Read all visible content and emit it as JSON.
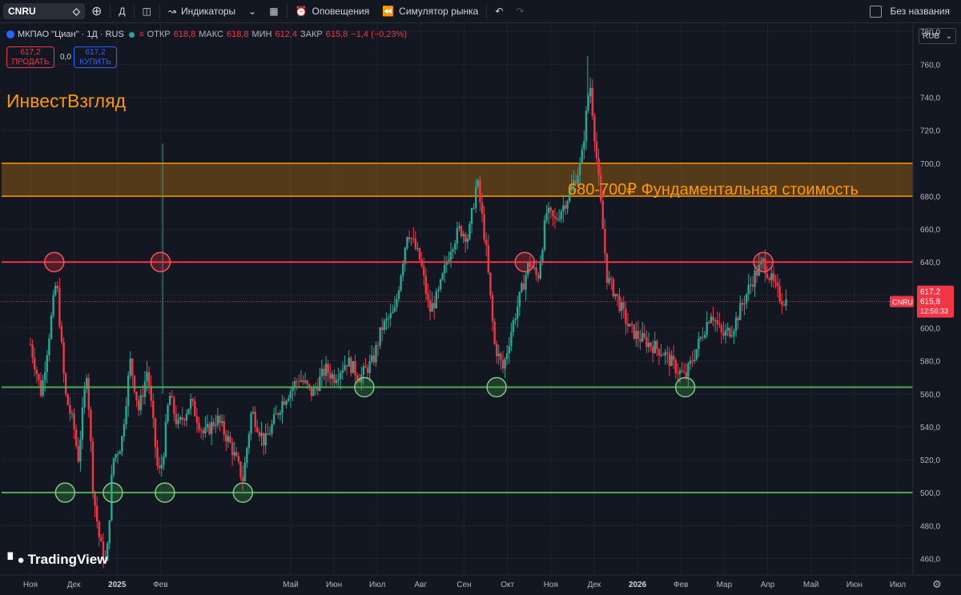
{
  "toolbar": {
    "symbol": "CNRU",
    "interval": "Д",
    "indicators": "Индикаторы",
    "alerts": "Оповещения",
    "replay": "Симулятор рынка",
    "layout_name": "Без названия"
  },
  "legend": {
    "title": "МКПАО \"Циан\" · 1Д · RUS",
    "open_label": "ОТКР",
    "open": "618,8",
    "high_label": "МАКС",
    "high": "618,8",
    "low_label": "МИН",
    "low": "612,4",
    "close_label": "ЗАКР",
    "close": "615,8",
    "change": "−1,4 (−0,23%)"
  },
  "trade": {
    "sell_price": "617,2",
    "sell_label": "ПРОДАТЬ",
    "spread": "0,0",
    "buy_price": "617,2",
    "buy_label": "КУПИТЬ"
  },
  "currency": "RUB",
  "annotations": {
    "author": "ИнвестВзгляд",
    "zone_label": "680-700₽ Фундаментальная стоимость"
  },
  "price_tags": {
    "symbol": "CNRU",
    "bid": "617,2",
    "last": "615,8",
    "countdown": "12:56:33"
  },
  "watermark": "TradingView",
  "colors": {
    "up": "#22ab94",
    "down": "#f23645",
    "support": "#4caf50",
    "resistance": "#f23645",
    "zone": "#ff9800",
    "background": "#131722"
  },
  "chart_data": {
    "type": "candlestick",
    "y_axis": {
      "ylim": [
        450,
        785
      ],
      "ticks": [
        "780,0",
        "760,0",
        "740,0",
        "720,0",
        "700,0",
        "680,0",
        "660,0",
        "640,0",
        "620,0",
        "600,0",
        "580,0",
        "560,0",
        "540,0",
        "520,0",
        "500,0",
        "480,0",
        "460,0"
      ],
      "tick_values": [
        780,
        760,
        740,
        720,
        700,
        680,
        660,
        640,
        620,
        600,
        580,
        560,
        540,
        520,
        500,
        480,
        460
      ]
    },
    "x_axis": {
      "labels": [
        "Ноя",
        "Дек",
        "2025",
        "Фев",
        "Май",
        "Июн",
        "Июл",
        "Авг",
        "Сен",
        "Окт",
        "Ноя",
        "Дек",
        "2026",
        "Фев",
        "Мар",
        "Апр",
        "Май",
        "Июн",
        "Июл"
      ],
      "months_from_start": [
        0,
        1,
        2,
        3,
        6,
        7,
        8,
        9,
        10,
        11,
        12,
        13,
        14,
        15,
        16,
        17,
        18,
        19,
        20
      ]
    },
    "horizontal_levels": [
      {
        "value": 640,
        "kind": "resistance"
      },
      {
        "value": 564,
        "kind": "support"
      },
      {
        "value": 500,
        "kind": "support"
      }
    ],
    "zone": {
      "from": 680,
      "to": 700
    },
    "touch_points": [
      {
        "month": 0.55,
        "value": 640,
        "kind": "resistance"
      },
      {
        "month": 3.0,
        "value": 640,
        "kind": "resistance"
      },
      {
        "month": 11.4,
        "value": 640,
        "kind": "resistance"
      },
      {
        "month": 16.9,
        "value": 640,
        "kind": "resistance"
      },
      {
        "month": 0.8,
        "value": 500,
        "kind": "support"
      },
      {
        "month": 1.9,
        "value": 500,
        "kind": "support"
      },
      {
        "month": 3.1,
        "value": 500,
        "kind": "support"
      },
      {
        "month": 4.9,
        "value": 500,
        "kind": "support"
      },
      {
        "month": 7.7,
        "value": 564,
        "kind": "support"
      },
      {
        "month": 10.75,
        "value": 564,
        "kind": "support"
      },
      {
        "month": 15.1,
        "value": 564,
        "kind": "support"
      }
    ],
    "price_path": [
      [
        0.0,
        590
      ],
      [
        0.25,
        560
      ],
      [
        0.45,
        600
      ],
      [
        0.6,
        630
      ],
      [
        0.8,
        560
      ],
      [
        1.0,
        540
      ],
      [
        1.1,
        520
      ],
      [
        1.3,
        575
      ],
      [
        1.45,
        500
      ],
      [
        1.6,
        470
      ],
      [
        1.75,
        455
      ],
      [
        1.9,
        520
      ],
      [
        2.1,
        530
      ],
      [
        2.3,
        580
      ],
      [
        2.5,
        550
      ],
      [
        2.7,
        575
      ],
      [
        2.95,
        510
      ],
      [
        3.05,
        520
      ],
      [
        3.2,
        560
      ],
      [
        3.4,
        540
      ],
      [
        3.7,
        555
      ],
      [
        4.0,
        535
      ],
      [
        4.3,
        545
      ],
      [
        4.6,
        530
      ],
      [
        4.9,
        508
      ],
      [
        5.1,
        550
      ],
      [
        5.4,
        530
      ],
      [
        5.8,
        555
      ],
      [
        6.2,
        570
      ],
      [
        6.5,
        560
      ],
      [
        6.8,
        575
      ],
      [
        7.0,
        570
      ],
      [
        7.3,
        580
      ],
      [
        7.6,
        570
      ],
      [
        7.9,
        580
      ],
      [
        8.1,
        600
      ],
      [
        8.4,
        610
      ],
      [
        8.7,
        660
      ],
      [
        9.0,
        640
      ],
      [
        9.2,
        610
      ],
      [
        9.4,
        620
      ],
      [
        9.7,
        650
      ],
      [
        9.9,
        660
      ],
      [
        10.1,
        655
      ],
      [
        10.3,
        690
      ],
      [
        10.5,
        650
      ],
      [
        10.7,
        590
      ],
      [
        10.9,
        575
      ],
      [
        11.1,
        600
      ],
      [
        11.3,
        620
      ],
      [
        11.5,
        640
      ],
      [
        11.7,
        630
      ],
      [
        11.9,
        670
      ],
      [
        12.1,
        665
      ],
      [
        12.4,
        680
      ],
      [
        12.7,
        700
      ],
      [
        12.9,
        750
      ],
      [
        13.1,
        690
      ],
      [
        13.3,
        630
      ],
      [
        13.5,
        620
      ],
      [
        13.8,
        600
      ],
      [
        14.0,
        595
      ],
      [
        14.3,
        590
      ],
      [
        14.6,
        585
      ],
      [
        14.9,
        575
      ],
      [
        15.1,
        570
      ],
      [
        15.4,
        590
      ],
      [
        15.7,
        610
      ],
      [
        15.95,
        595
      ],
      [
        16.2,
        600
      ],
      [
        16.5,
        620
      ],
      [
        16.7,
        632
      ],
      [
        16.9,
        640
      ],
      [
        17.1,
        628
      ],
      [
        17.3,
        618
      ],
      [
        17.45,
        616
      ]
    ]
  }
}
